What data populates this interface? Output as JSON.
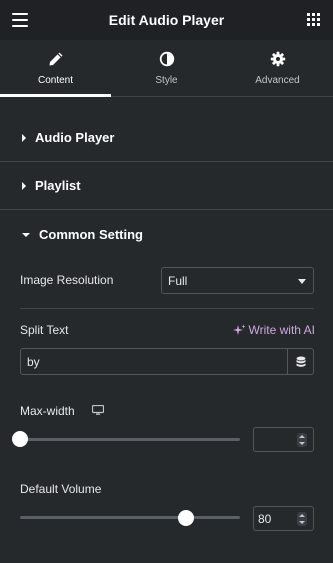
{
  "header": {
    "title": "Edit Audio Player",
    "menu_icon": "hamburger-menu-icon",
    "apps_icon": "grid-icon"
  },
  "tabs": [
    {
      "label": "Content",
      "icon": "pencil-icon",
      "active": true
    },
    {
      "label": "Style",
      "icon": "half-circle-icon",
      "active": false
    },
    {
      "label": "Advanced",
      "icon": "gear-icon",
      "active": false
    }
  ],
  "sections": [
    {
      "label": "Audio Player",
      "expanded": false
    },
    {
      "label": "Playlist",
      "expanded": false
    },
    {
      "label": "Common Setting",
      "expanded": true
    }
  ],
  "common_setting": {
    "image_resolution": {
      "label": "Image Resolution",
      "value": "Full"
    },
    "split_text": {
      "label": "Split Text",
      "value": "by",
      "ai_link": "Write with AI"
    },
    "max_width": {
      "label": "Max-width",
      "value": "",
      "slider_fraction": 0.0
    },
    "default_volume": {
      "label": "Default Volume",
      "value": "80",
      "slider_fraction": 0.8
    }
  },
  "colors": {
    "panel_bg": "#26292c",
    "header_bg": "#1f2124",
    "ai_accent": "#d0a6e4",
    "border": "#50565d"
  }
}
